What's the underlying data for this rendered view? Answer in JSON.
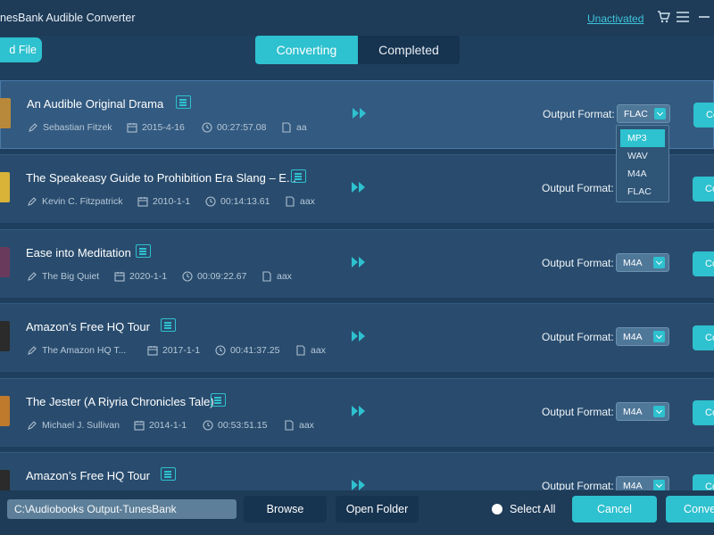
{
  "app": {
    "title": "nesBank Audible Converter"
  },
  "header": {
    "unactivated": "Unactivated"
  },
  "toolbar": {
    "add_file": "d File"
  },
  "tabs": [
    {
      "label": "Converting"
    },
    {
      "label": "Completed"
    }
  ],
  "output_label": "Output Format:",
  "convert_button_label": "Co",
  "items": [
    {
      "title": "An Audible Original Drama",
      "author": "Sebastian Fitzek",
      "date": "2015-4-16",
      "duration": "00:27:57.08",
      "ext": "aa",
      "format": "FLAC",
      "cover_color": "#b8893a"
    },
    {
      "title": "The Speakeasy Guide to Prohibition Era Slang – E...",
      "author": "Kevin C. Fitzpatrick",
      "date": "2010-1-1",
      "duration": "00:14:13.61",
      "ext": "aax",
      "format": "",
      "cover_color": "#d8b338"
    },
    {
      "title": "Ease into Meditation",
      "author": "The Big Quiet",
      "date": "2020-1-1",
      "duration": "00:09:22.67",
      "ext": "aax",
      "format": "M4A",
      "cover_color": "#6a3a5c"
    },
    {
      "title": "Amazon’s Free HQ Tour",
      "author": "The Amazon HQ T...",
      "date": "2017-1-1",
      "duration": "00:41:37.25",
      "ext": "aax",
      "format": "M4A",
      "cover_color": "#2b2b2b"
    },
    {
      "title": "The Jester (A Riyria Chronicles Tale)",
      "author": "Michael J. Sullivan",
      "date": "2014-1-1",
      "duration": "00:53:51.15",
      "ext": "aax",
      "format": "M4A",
      "cover_color": "#c07a2c"
    },
    {
      "title": "Amazon’s Free HQ Tour",
      "author": "",
      "date": "",
      "duration": "",
      "ext": "",
      "format": "M4A",
      "cover_color": "#2b2b2b"
    }
  ],
  "dropdown": {
    "options": [
      "MP3",
      "WAV",
      "M4A",
      "FLAC"
    ],
    "highlighted": "MP3"
  },
  "footer": {
    "output_path": "C:\\Audiobooks Output-TunesBank",
    "browse": "Browse",
    "open_folder": "Open Folder",
    "select_all": "Select All",
    "cancel": "Cancel",
    "convert_all": "Conve"
  },
  "colors": {
    "accent": "#2ec1cf",
    "background": "#1f3f5e",
    "row": "#294c6e",
    "selected_row": "#335a80"
  }
}
